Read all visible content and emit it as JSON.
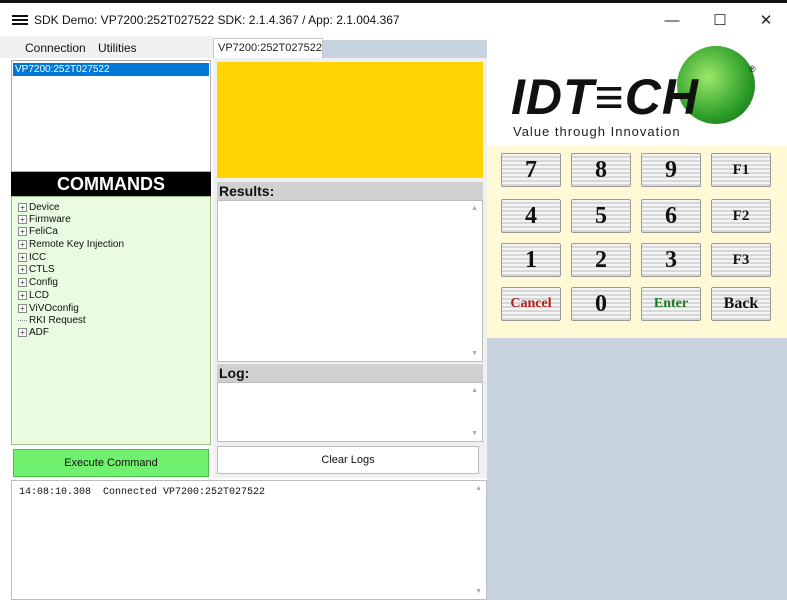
{
  "window": {
    "title": "SDK Demo: VP7200:252T027522  SDK: 2.1.4.367  /  App: 2.1.004.367",
    "minimize": "—",
    "maximize": "☐",
    "close": "✕"
  },
  "menu": {
    "items": [
      "Connection",
      "Utilities"
    ]
  },
  "device_list": {
    "selected": "VP7200:252T027522"
  },
  "commands": {
    "header": "COMMANDS",
    "tree": [
      {
        "label": "Device",
        "expandable": true
      },
      {
        "label": "Firmware",
        "expandable": true
      },
      {
        "label": "FeliCa",
        "expandable": true
      },
      {
        "label": "Remote Key Injection",
        "expandable": true
      },
      {
        "label": "ICC",
        "expandable": true
      },
      {
        "label": "CTLS",
        "expandable": true
      },
      {
        "label": "Config",
        "expandable": true
      },
      {
        "label": "LCD",
        "expandable": true
      },
      {
        "label": "ViVOconfig",
        "expandable": true
      },
      {
        "label": "RKI Request",
        "expandable": false
      },
      {
        "label": "ADF",
        "expandable": true
      }
    ],
    "execute_label": "Execute Command"
  },
  "tab": {
    "label": "VP7200:252T027522"
  },
  "results": {
    "header": "Results:",
    "text": ""
  },
  "log": {
    "header": "Log:",
    "text": "",
    "clear_label": "Clear Logs"
  },
  "bottom_log": {
    "line": "14:08:10.308  Connected VP7200:252T027522"
  },
  "logo": {
    "text": "IDT≡CH",
    "reg": "®",
    "tagline": "Value through Innovation"
  },
  "keypad": {
    "rows": [
      [
        "7",
        "8",
        "9",
        "F1"
      ],
      [
        "4",
        "5",
        "6",
        "F2"
      ],
      [
        "1",
        "2",
        "3",
        "F3"
      ],
      [
        "Cancel",
        "0",
        "Enter",
        "Back"
      ]
    ]
  },
  "colors": {
    "yellow_display": "#ffd400",
    "command_panel": "#e9fbe1",
    "execute_button": "#6ff06f",
    "keypad_background": "#fff9d6",
    "right_fill": "#c8d3e0"
  }
}
